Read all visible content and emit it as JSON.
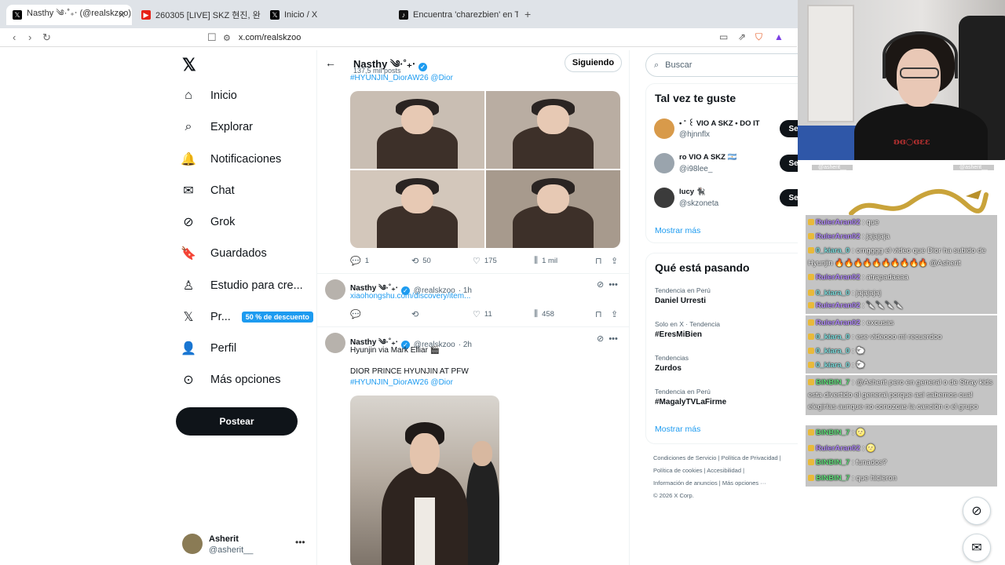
{
  "browser": {
    "tabs": [
      {
        "title": "Nasthy ༄·˚₊‧ (@realskzoo) / X",
        "icon": "x-logo-icon",
        "active": true
      },
      {
        "title": "260305 [LIVE] SKZ 현진, 완벽 조각미",
        "icon": "youtube-icon",
        "active": false
      },
      {
        "title": "Inicio / X",
        "icon": "x-logo-icon",
        "active": false
      },
      {
        "title": "Encuentra 'charezbien' en TikTok | Bu",
        "icon": "tiktok-icon",
        "active": false
      }
    ],
    "new_tab": "+",
    "url": "x.com/realskzoo"
  },
  "nav": {
    "logo": "𝕏",
    "items": [
      {
        "label": "Inicio",
        "icon": "⌂"
      },
      {
        "label": "Explorar",
        "icon": "⌕"
      },
      {
        "label": "Notificaciones",
        "icon": "🔔"
      },
      {
        "label": "Chat",
        "icon": "✉"
      },
      {
        "label": "Grok",
        "icon": "⊘"
      },
      {
        "label": "Guardados",
        "icon": "🔖"
      },
      {
        "label": "Estudio para cre...",
        "icon": "♙"
      },
      {
        "label": "Pr...",
        "icon": "𝕏"
      },
      {
        "label": "Perfil",
        "icon": "👤"
      },
      {
        "label": "Más opciones",
        "icon": "⊙"
      }
    ],
    "premium_badge": "50 % de descuento",
    "post_button": "Postear",
    "account": {
      "name": "Asherit",
      "handle": "@asherit__"
    }
  },
  "profile": {
    "name": "Nasthy ༄·˚₊‧",
    "posts_count": "137,5 mil posts",
    "follow_button": "Siguiendo"
  },
  "tweets": [
    {
      "hashtags": "#HYUNJIN_DiorAW26 @Dior",
      "replies": "1",
      "reposts": "50",
      "likes": "175",
      "views": "1 mil"
    },
    {
      "name": "Nasthy ༄·˚₊‧",
      "handle": "@realskzoo",
      "time": "· 1h",
      "link": "xiaohongshu.com/discovery/item...",
      "replies": "",
      "reposts": "",
      "likes": "11",
      "views": "458"
    },
    {
      "name": "Nasthy ༄·˚₊‧",
      "handle": "@realskzoo",
      "time": "· 2h",
      "line1": "Hyunjin via Mark Elliar 🎬",
      "line2": "DIOR PRINCE HYUNJIN AT PFW",
      "hashtags": "#HYUNJIN_DiorAW26 @Dior"
    }
  ],
  "sidebar": {
    "search_placeholder": "Buscar",
    "suggest_title": "Tal vez te guste",
    "suggestions": [
      {
        "name": "• ˚ ꒰ VIO A SKZ • DO IT",
        "handle": "@hjnnflx",
        "button": "Seguir"
      },
      {
        "name": "ro VIO A SKZ 🇦🇷",
        "handle": "@i98lee_",
        "button": "Seguir"
      },
      {
        "name": "lucy 🐈‍⬛",
        "handle": "@skzoneta",
        "button": "Seguir"
      }
    ],
    "show_more": "Mostrar más",
    "trends_title": "Qué está pasando",
    "trends": [
      {
        "context": "Tendencia en Perú",
        "title": "Daniel Urresti"
      },
      {
        "context": "Solo en X · Tendencia",
        "title": "#EresMiBien"
      },
      {
        "context": "Tendencias",
        "title": "Zurdos"
      },
      {
        "context": "Tendencia en Perú",
        "title": "#MagalyTVLaFirme"
      }
    ],
    "trends_more": "Mostrar más",
    "footer": {
      "l1a": "Condiciones de Servicio",
      "l1b": "Política de Privacidad",
      "l2a": "Política de cookies",
      "l2b": "Accesibilidad",
      "l3a": "Información de anuncios",
      "l3b": "Más opciones ···",
      "copyright": "© 2026 X Corp."
    }
  },
  "stream": {
    "chat_head_left": "@asherit__",
    "chat_head_right": "@asherit__",
    "webcam_shirt_print": "ʚɞ○ɞɛɛ",
    "messages": [
      {
        "user": "RulerAran02",
        "text": ": que",
        "color": "#b58cff"
      },
      {
        "user": "RulerAran02",
        "text": ": jajajaja",
        "color": "#b58cff"
      },
      {
        "user": "0_kiara_0",
        "text": ": omgggg el video que Dior ha subido de Hyunjin 🔥🔥🔥🔥🔥🔥🔥🔥🔥🔥 @Asherit",
        "color": "#7fe0e0"
      },
      {
        "user": "RulerAran02",
        "text": ": atrapadaaaa",
        "color": "#b58cff"
      },
      {
        "user": "0_kiara_0",
        "text": ": jajajajaj",
        "color": "#7fe0e0"
      },
      {
        "user": "RulerAran02",
        "text": ": 🔪🔪🔪🔪",
        "color": "#b58cff"
      },
      {
        "user": "RulerAran02",
        "text": ": excusas",
        "color": "#b58cff"
      },
      {
        "user": "0_kiara_0",
        "text": ": ese videooo mi recuerdoo",
        "color": "#7fe0e0"
      },
      {
        "user": "0_kiara_0",
        "text": ": 🐑",
        "color": "#7fe0e0"
      },
      {
        "user": "0_kiara_0",
        "text": ": 🐑",
        "color": "#7fe0e0"
      },
      {
        "user": "BINBIN_7",
        "text": ": @Asherit pero en general o de Stray kids esta divertido el general porque así sabemos cual elegirías aunque no conozcas la canción o el grupo",
        "color": "#5fe07a"
      },
      {
        "user": "BINBIN_7",
        "text": ": 🌝",
        "color": "#5fe07a"
      },
      {
        "user": "RulerAran02",
        "text": ": 🌝",
        "color": "#b58cff"
      },
      {
        "user": "BINBIN_7",
        "text": ": funados?",
        "color": "#5fe07a"
      },
      {
        "user": "BINBIN_7",
        "text": ": que hicieron",
        "color": "#5fe07a"
      }
    ]
  },
  "floating": {
    "grok_icon": "⊘",
    "messages_icon": "✉"
  }
}
